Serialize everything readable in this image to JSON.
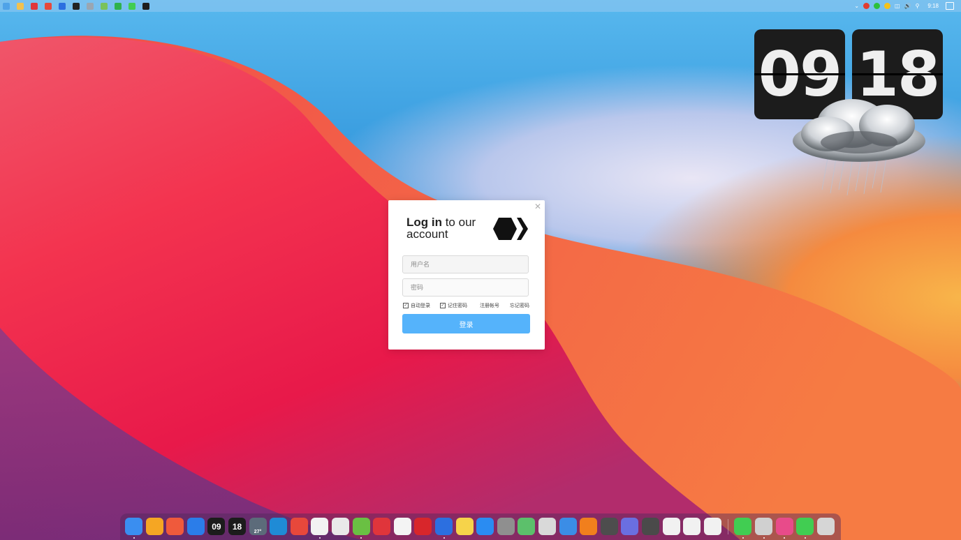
{
  "clock": {
    "hours": "09",
    "minutes": "18"
  },
  "taskbar": {
    "apps": [
      {
        "icon": "windows-start-icon",
        "color": "#4fa3e8"
      },
      {
        "icon": "file-explorer-icon",
        "color": "#f2c14e"
      },
      {
        "icon": "netease-music-icon",
        "color": "#e0353b"
      },
      {
        "icon": "chrome-icon",
        "color": "#e7483b"
      },
      {
        "icon": "edit-app-icon",
        "color": "#2c6fe0"
      },
      {
        "icon": "record-icon",
        "color": "#222222"
      },
      {
        "icon": "notes-icon",
        "color": "#9aa6b2"
      },
      {
        "icon": "bubble-app-icon",
        "color": "#7ac25a"
      },
      {
        "icon": "green-app-icon",
        "color": "#2fb24c"
      },
      {
        "icon": "qt-creator-icon",
        "color": "#41cd52"
      },
      {
        "icon": "dev-app-icon",
        "color": "#1e1e1e"
      }
    ],
    "tray": [
      {
        "icon": "tray-chevron-icon",
        "color": "#ffffff"
      },
      {
        "icon": "qq-tray-icon",
        "color": "#e23c2e"
      },
      {
        "icon": "wechat-tray-icon",
        "color": "#2cc03b"
      },
      {
        "icon": "yellow-app-tray-icon",
        "color": "#f5c21b"
      },
      {
        "icon": "network-tray-icon",
        "color": "#ffffff"
      },
      {
        "icon": "volume-tray-icon",
        "color": "#ffffff"
      },
      {
        "icon": "ime-tray-icon",
        "color": "#ffffff"
      }
    ],
    "time": "9:18"
  },
  "login": {
    "title_bold": "Log in",
    "title_rest": " to our",
    "title_line2": "account",
    "username_placeholder": "用户名",
    "password_placeholder": "密码",
    "auto_login": "自动登录",
    "remember_password": "记住密码",
    "register": "注册帐号",
    "forgot_password": "忘记密码",
    "login_button": "登录",
    "close": "✕",
    "accent": "#55b3fb"
  },
  "dock": {
    "items": [
      {
        "icon": "finder-icon",
        "label": "",
        "color": "#3a8ef0",
        "running": true
      },
      {
        "icon": "home-icon",
        "label": "",
        "color": "#f5a623",
        "running": false
      },
      {
        "icon": "launchpad-icon",
        "label": "",
        "color": "#ef5a3c",
        "running": false
      },
      {
        "icon": "windows-icon",
        "label": "",
        "color": "#2b7de9",
        "running": false
      },
      {
        "icon": "flip-hour-icon",
        "label": "09",
        "color": "#1c1c1c",
        "running": false
      },
      {
        "icon": "flip-minute-icon",
        "label": "18",
        "color": "#1c1c1c",
        "running": false
      },
      {
        "icon": "weather-icon",
        "label": "27°",
        "color": "#5c6b7a",
        "running": false
      },
      {
        "icon": "edge-icon",
        "label": "",
        "color": "#1f8bd6",
        "running": false
      },
      {
        "icon": "chrome-icon",
        "label": "",
        "color": "#e7483b",
        "running": false
      },
      {
        "icon": "qq-icon",
        "label": "",
        "color": "#f2f2f2",
        "running": true
      },
      {
        "icon": "wechat-icon",
        "label": "",
        "color": "#e9e9e9",
        "running": false
      },
      {
        "icon": "green-ball-icon",
        "label": "",
        "color": "#6ac043",
        "running": true
      },
      {
        "icon": "netease-music-icon",
        "label": "",
        "color": "#e0353b",
        "running": false
      },
      {
        "icon": "music-icon",
        "label": "",
        "color": "#f4f4f4",
        "running": false
      },
      {
        "icon": "red-app-icon",
        "label": "",
        "color": "#d8262b",
        "running": false
      },
      {
        "icon": "pen-app-icon",
        "label": "",
        "color": "#2c6fe0",
        "running": true
      },
      {
        "icon": "notes-icon",
        "label": "",
        "color": "#f6d34a",
        "running": false
      },
      {
        "icon": "app-store-icon",
        "label": "",
        "color": "#2a8cf2",
        "running": false
      },
      {
        "icon": "system-preferences-icon",
        "label": "",
        "color": "#8f8f8f",
        "running": false
      },
      {
        "icon": "colorful-app-icon",
        "label": "",
        "color": "#5cc06b",
        "running": false
      },
      {
        "icon": "screenshot-icon",
        "label": "",
        "color": "#d9d9d9",
        "running": false
      },
      {
        "icon": "search-icon",
        "label": "",
        "color": "#3b8de6",
        "running": false
      },
      {
        "icon": "orange-ring-icon",
        "label": "",
        "color": "#f17f1d",
        "running": false
      },
      {
        "icon": "calculator-icon",
        "label": "",
        "color": "#4d4d4d",
        "running": false
      },
      {
        "icon": "volume-icon",
        "label": "",
        "color": "#6a6fe0",
        "running": false
      },
      {
        "icon": "power-icon",
        "label": "",
        "color": "#4a4a4a",
        "running": false
      },
      {
        "icon": "more-icon",
        "label": "",
        "color": "#f1f1f1",
        "running": false
      },
      {
        "icon": "chevron-down-icon",
        "label": "",
        "color": "#f1f1f1",
        "running": false
      },
      {
        "icon": "chevron-down-icon",
        "label": "",
        "color": "#f1f1f1",
        "running": false
      },
      {
        "icon": "qt-icon",
        "label": "",
        "color": "#41cd52",
        "running": true
      },
      {
        "icon": "printer-icon",
        "label": "",
        "color": "#d0d0d0",
        "running": true
      },
      {
        "icon": "color-wheel-icon",
        "label": "",
        "color": "#e84b8a",
        "running": true
      },
      {
        "icon": "qt-icon",
        "label": "",
        "color": "#41cd52",
        "running": true
      },
      {
        "icon": "trash-icon",
        "label": "",
        "color": "#d6d6d6",
        "running": false
      }
    ]
  }
}
